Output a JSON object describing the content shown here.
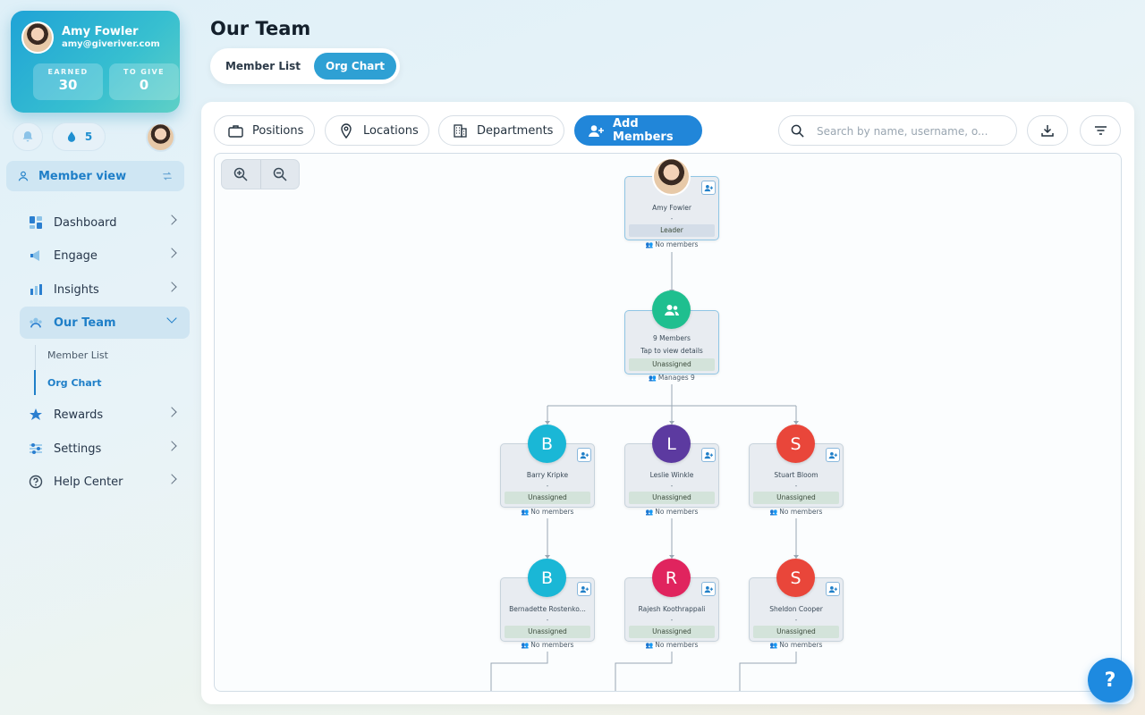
{
  "user": {
    "name": "Amy Fowler",
    "email": "amy@giveriver.com",
    "earned_label": "EARNED",
    "earned_value": "30",
    "to_give_label": "TO GIVE",
    "to_give_value": "0",
    "drops": "5"
  },
  "sidebar": {
    "member_view": "Member view",
    "items": [
      {
        "label": "Dashboard",
        "icon": "dashboard-icon"
      },
      {
        "label": "Engage",
        "icon": "megaphone-icon"
      },
      {
        "label": "Insights",
        "icon": "bar-chart-icon"
      },
      {
        "label": "Our Team",
        "icon": "team-icon"
      },
      {
        "label": "Rewards",
        "icon": "star-icon"
      },
      {
        "label": "Settings",
        "icon": "sliders-icon"
      },
      {
        "label": "Help Center",
        "icon": "help-circle-icon"
      }
    ],
    "sub_items": [
      {
        "label": "Member List"
      },
      {
        "label": "Org Chart"
      }
    ]
  },
  "header": {
    "title": "Our Team",
    "tabs": [
      {
        "label": "Member List"
      },
      {
        "label": "Org Chart"
      }
    ]
  },
  "toolbar": {
    "positions": "Positions",
    "locations": "Locations",
    "departments": "Departments",
    "add_members": "Add Members",
    "search_placeholder": "Search by name, username, o..."
  },
  "org": {
    "root": {
      "name": "Amy Fowler",
      "dash": "-",
      "role": "Leader",
      "footer": "No members"
    },
    "group": {
      "line1": "9 Members",
      "line2": "Tap to view details",
      "role": "Unassigned",
      "footer": "Manages 9"
    },
    "level2": [
      {
        "initial": "B",
        "name": "Barry Kripke",
        "dash": "-",
        "role": "Unassigned",
        "footer": "No members",
        "color": "#1ab7d6"
      },
      {
        "initial": "L",
        "name": "Leslie Winkle",
        "dash": "-",
        "role": "Unassigned",
        "footer": "No members",
        "color": "#5c3aa0"
      },
      {
        "initial": "S",
        "name": "Stuart Bloom",
        "dash": "-",
        "role": "Unassigned",
        "footer": "No members",
        "color": "#e9463a"
      }
    ],
    "level3": [
      {
        "initial": "B",
        "name": "Bernadette Rostenko...",
        "dash": "-",
        "role": "Unassigned",
        "footer": "No members",
        "color": "#1ab7d6"
      },
      {
        "initial": "R",
        "name": "Rajesh Koothrappali",
        "dash": "-",
        "role": "Unassigned",
        "footer": "No members",
        "color": "#e0245e"
      },
      {
        "initial": "S",
        "name": "Sheldon Cooper",
        "dash": "-",
        "role": "Unassigned",
        "footer": "No members",
        "color": "#e9463a"
      }
    ]
  },
  "help_fab": "?"
}
